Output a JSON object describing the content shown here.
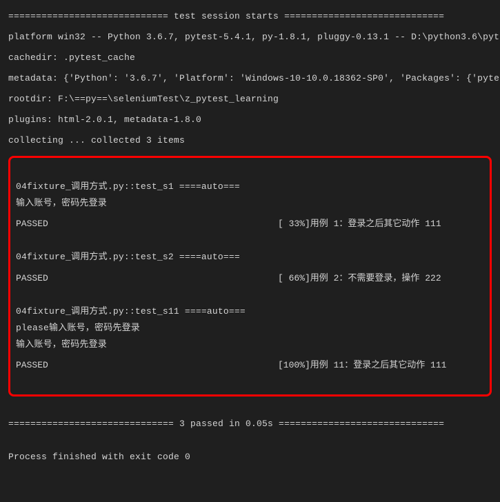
{
  "header": {
    "banner": "============================= test session starts =============================",
    "platform": "platform win32 -- Python 3.6.7, pytest-5.4.1, py-1.8.1, pluggy-0.13.1 -- D:\\python3.6\\pyt",
    "cachedir": "cachedir: .pytest_cache",
    "metadata": "metadata: {'Python': '3.6.7', 'Platform': 'Windows-10-10.0.18362-SP0', 'Packages': {'pyte",
    "rootdir": "rootdir: F:\\==py==\\seleniumTest\\z_pytest_learning",
    "plugins": "plugins: html-2.0.1, metadata-1.8.0",
    "collecting": "collecting ... collected 3 items"
  },
  "tests": {
    "t1": {
      "name": "04fixture_调用方式.py::test_s1 ====auto===",
      "line1": "输入账号，密码先登录",
      "passed": "PASSED",
      "pct": "[ 33%]用例 1：登录之后其它动作 111"
    },
    "t2": {
      "name": "04fixture_调用方式.py::test_s2 ====auto===",
      "passed": "PASSED",
      "pct": "[ 66%]用例 2：不需要登录，操作 222"
    },
    "t3": {
      "name": "04fixture_调用方式.py::test_s11 ====auto===",
      "line1": "please输入账号，密码先登录",
      "line2": "输入账号，密码先登录",
      "passed": "PASSED",
      "pct": "[100%]用例 11：登录之后其它动作 111"
    }
  },
  "footer": {
    "summary": "============================== 3 passed in 0.05s ==============================",
    "exit": "Process finished with exit code 0"
  }
}
